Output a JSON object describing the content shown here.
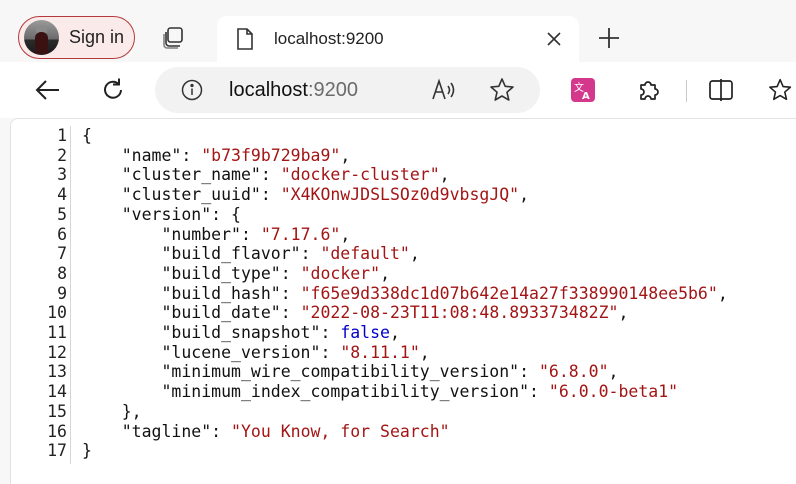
{
  "tabstrip": {
    "signin_label": "Sign in",
    "tab_title": "localhost:9200",
    "icons": [
      "avatar",
      "tab-actions-icon",
      "page-icon",
      "close-icon",
      "plus-icon"
    ]
  },
  "toolbar": {
    "url_host": "localhost",
    "url_port": ":9200",
    "icons": [
      "back-arrow-icon",
      "refresh-icon",
      "info-icon",
      "read-aloud-icon",
      "favorite-star-icon",
      "translate-icon",
      "extensions-icon",
      "split-screen-icon",
      "favorites-icon"
    ]
  },
  "colors": {
    "signin_border": "#b33a3a",
    "json_string": "#a31515",
    "json_boolean": "#0000c8",
    "translate_icon": "#d4388c"
  },
  "json_view": {
    "lines": [
      {
        "n": "1",
        "indent": 0,
        "key": "",
        "value": "{",
        "vtype": "p",
        "tail": ""
      },
      {
        "n": "2",
        "indent": 1,
        "key": "\"name\"",
        "value": "\"b73f9b729ba9\"",
        "vtype": "s",
        "tail": ","
      },
      {
        "n": "3",
        "indent": 1,
        "key": "\"cluster_name\"",
        "value": "\"docker-cluster\"",
        "vtype": "s",
        "tail": ","
      },
      {
        "n": "4",
        "indent": 1,
        "key": "\"cluster_uuid\"",
        "value": "\"X4KOnwJDSLSOz0d9vbsgJQ\"",
        "vtype": "s",
        "tail": ","
      },
      {
        "n": "5",
        "indent": 1,
        "key": "\"version\"",
        "value": "{",
        "vtype": "p",
        "tail": ""
      },
      {
        "n": "6",
        "indent": 2,
        "key": "\"number\"",
        "value": "\"7.17.6\"",
        "vtype": "s",
        "tail": ","
      },
      {
        "n": "7",
        "indent": 2,
        "key": "\"build_flavor\"",
        "value": "\"default\"",
        "vtype": "s",
        "tail": ","
      },
      {
        "n": "8",
        "indent": 2,
        "key": "\"build_type\"",
        "value": "\"docker\"",
        "vtype": "s",
        "tail": ","
      },
      {
        "n": "9",
        "indent": 2,
        "key": "\"build_hash\"",
        "value": "\"f65e9d338dc1d07b642e14a27f338990148ee5b6\"",
        "vtype": "s",
        "tail": ","
      },
      {
        "n": "10",
        "indent": 2,
        "key": "\"build_date\"",
        "value": "\"2022-08-23T11:08:48.893373482Z\"",
        "vtype": "s",
        "tail": ","
      },
      {
        "n": "11",
        "indent": 2,
        "key": "\"build_snapshot\"",
        "value": "false",
        "vtype": "b",
        "tail": ","
      },
      {
        "n": "12",
        "indent": 2,
        "key": "\"lucene_version\"",
        "value": "\"8.11.1\"",
        "vtype": "s",
        "tail": ","
      },
      {
        "n": "13",
        "indent": 2,
        "key": "\"minimum_wire_compatibility_version\"",
        "value": "\"6.8.0\"",
        "vtype": "s",
        "tail": ","
      },
      {
        "n": "14",
        "indent": 2,
        "key": "\"minimum_index_compatibility_version\"",
        "value": "\"6.0.0-beta1\"",
        "vtype": "s",
        "tail": ""
      },
      {
        "n": "15",
        "indent": 1,
        "key": "",
        "value": "},",
        "vtype": "p",
        "tail": ""
      },
      {
        "n": "16",
        "indent": 1,
        "key": "\"tagline\"",
        "value": "\"You Know, for Search\"",
        "vtype": "s",
        "tail": ""
      },
      {
        "n": "17",
        "indent": 0,
        "key": "",
        "value": "}",
        "vtype": "p",
        "tail": ""
      }
    ]
  }
}
